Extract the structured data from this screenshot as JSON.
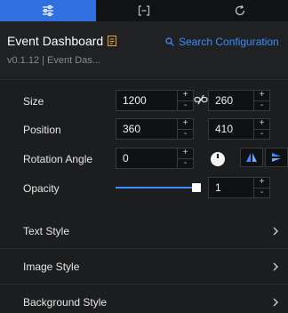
{
  "tabs": [
    {
      "icon": "sliders-icon",
      "active": true
    },
    {
      "icon": "brackets-icon",
      "active": false
    },
    {
      "icon": "refresh-icon",
      "active": false
    }
  ],
  "header": {
    "title": "Event Dashboard",
    "search_label": "Search Configuration",
    "subtitle": "v0.1.12 | Event Das..."
  },
  "properties": {
    "size": {
      "label": "Size",
      "width": "1200",
      "height": "260"
    },
    "position": {
      "label": "Position",
      "x": "360",
      "y": "410"
    },
    "rotation": {
      "label": "Rotation Angle",
      "value": "0"
    },
    "opacity": {
      "label": "Opacity",
      "value": "1",
      "level": 1.0
    }
  },
  "stepper": {
    "plus": "+",
    "minus": "-"
  },
  "sections": [
    {
      "label": "Text Style"
    },
    {
      "label": "Image Style"
    },
    {
      "label": "Background Style"
    }
  ],
  "colors": {
    "accent": "#3d8bff",
    "active_tab": "#2f6fe0",
    "title_icon": "#e8a33d"
  }
}
